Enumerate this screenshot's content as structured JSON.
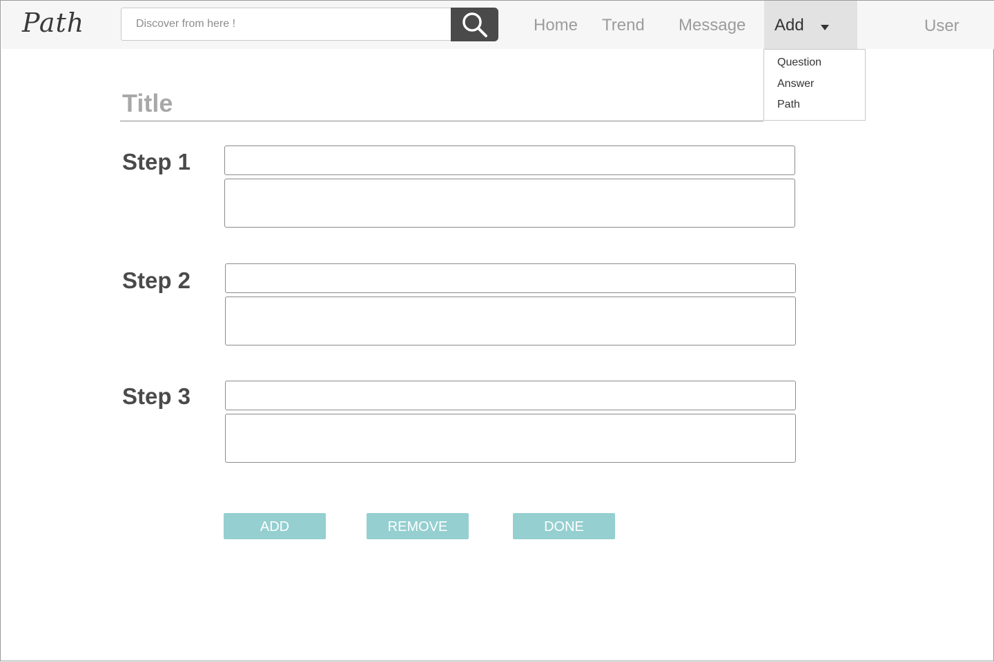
{
  "app": {
    "logo": "Path"
  },
  "search": {
    "placeholder": "Discover from here !",
    "icon": "search-icon"
  },
  "nav": {
    "home": "Home",
    "trend": "Trend",
    "message": "Message",
    "add": "Add",
    "user": "User"
  },
  "add_menu": {
    "items": [
      "Question",
      "Answer",
      "Path"
    ]
  },
  "form": {
    "title_placeholder": "Title",
    "steps": [
      {
        "label": "Step 1"
      },
      {
        "label": "Step 2"
      },
      {
        "label": "Step 3"
      }
    ]
  },
  "actions": {
    "add": "ADD",
    "remove": "REMOVE",
    "done": "DONE"
  },
  "colors": {
    "topbar_bg": "#f6f6f6",
    "active_nav_bg": "#e2e2e2",
    "button_bg": "#95cfd0",
    "search_button_bg": "#4a4a4a"
  }
}
